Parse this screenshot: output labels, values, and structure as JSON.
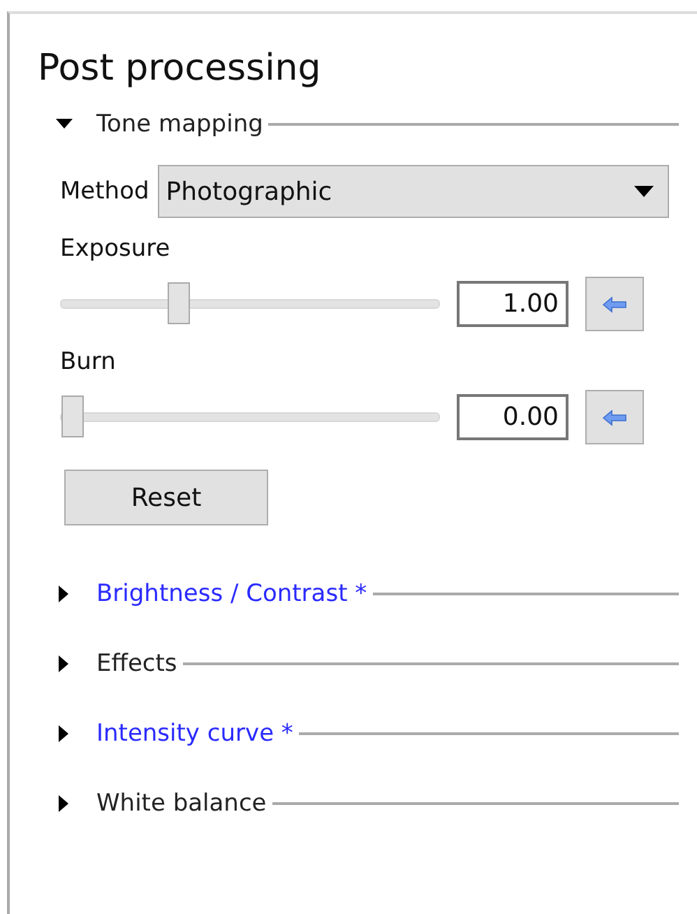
{
  "panel": {
    "title": "Post processing"
  },
  "sections": [
    {
      "label": "Tone mapping",
      "expanded": true,
      "modified": false,
      "method": {
        "label": "Method",
        "value": "Photographic"
      },
      "sliders": [
        {
          "label": "Exposure",
          "level": 0.3,
          "value": "1.00"
        },
        {
          "label": "Burn",
          "level": 0,
          "value": "0.00"
        }
      ],
      "reset": "Reset"
    },
    {
      "label": "Brightness / Contrast *",
      "expanded": false,
      "modified": true
    },
    {
      "label": "Effects",
      "expanded": false,
      "modified": false
    },
    {
      "label": "Intensity curve *",
      "expanded": false,
      "modified": true
    },
    {
      "label": "White balance",
      "expanded": false,
      "modified": false
    }
  ]
}
